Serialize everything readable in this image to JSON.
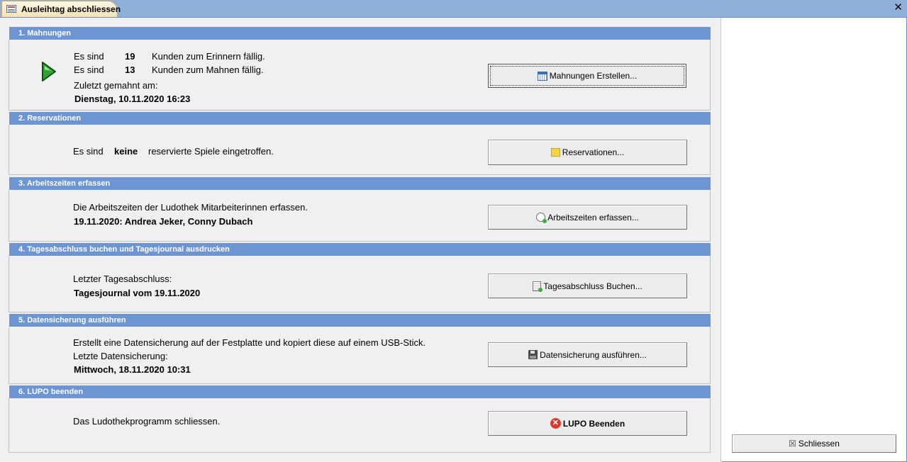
{
  "window": {
    "tab_title": "Ausleihtag abschliessen",
    "close_glyph": "✕"
  },
  "sections": [
    {
      "header": "1. Mahnungen",
      "line1_prefix": "Es sind",
      "line1_count": "19",
      "line1_suffix": "Kunden zum Erinnern fällig.",
      "line2_prefix": "Es sind",
      "line2_count": "13",
      "line2_suffix": "Kunden zum Mahnen fällig.",
      "last_label": "Zuletzt gemahnt am:",
      "last_value": "Dienstag, 10.11.2020 16:23",
      "button": "Mahnungen Erstellen...",
      "button_icon": "calendar-icon",
      "status_icon": "green-arrow-icon"
    },
    {
      "header": "2. Reservationen",
      "text_prefix": "Es sind",
      "text_value": "keine",
      "text_suffix": "reservierte Spiele eingetroffen.",
      "button": "Reservationen...",
      "button_icon": "note-icon"
    },
    {
      "header": "3. Arbeitszeiten erfassen",
      "text": "Die Arbeitszeiten der Ludothek Mitarbeiterinnen erfassen.",
      "value": "19.11.2020: Andrea Jeker, Conny Dubach",
      "button": "Arbeitszeiten erfassen...",
      "button_icon": "clock-add-icon"
    },
    {
      "header": "4. Tagesabschluss buchen und Tagesjournal ausdrucken",
      "text": "Letzter Tagesabschluss:",
      "value": "Tagesjournal vom 19.11.2020",
      "button": "Tagesabschluss Buchen...",
      "button_icon": "journal-add-icon"
    },
    {
      "header": "5. Datensicherung ausführen",
      "text": "Erstellt eine Datensicherung auf der Festplatte und kopiert diese auf einem USB-Stick.",
      "text2": "Letzte Datensicherung:",
      "value": "Mittwoch, 18.11.2020 10:31",
      "button": "Datensicherung ausführen...",
      "button_icon": "floppy-disk-icon"
    },
    {
      "header": "6. LUPO beenden",
      "text": "Das Ludothekprogramm schliessen.",
      "button": "LUPO Beenden",
      "button_icon": "stop-icon"
    }
  ],
  "side": {
    "close_button": "Schliessen",
    "close_icon": "close-small-icon"
  },
  "colors": {
    "section_header": "#6d95d1",
    "tab_bar": "#8fb0d9",
    "form_bg": "#f0f0f0"
  }
}
